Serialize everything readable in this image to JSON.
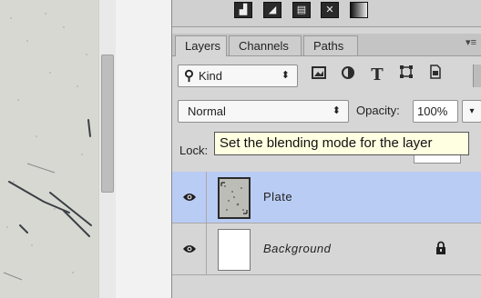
{
  "panel": {
    "tabs": [
      {
        "label": "Layers",
        "active": true
      },
      {
        "label": "Channels",
        "active": false
      },
      {
        "label": "Paths",
        "active": false
      }
    ],
    "menu_glyph": "▾≡"
  },
  "filter": {
    "kind_label": "Kind",
    "kind_arrows": "⬍",
    "icons": [
      "image-filter-icon",
      "adjustment-filter-icon",
      "type-filter-icon",
      "shape-filter-icon",
      "smart-object-filter-icon"
    ],
    "type_glyph": "T"
  },
  "blend": {
    "mode": "Normal",
    "arrows": "⬍",
    "opacity_label": "Opacity:",
    "opacity_value": "100%",
    "opacity_arrow": "▾"
  },
  "lock": {
    "label": "Lock:"
  },
  "tooltip": {
    "text": "Set the blending mode for the layer"
  },
  "layers": [
    {
      "name": "Plate",
      "visible": true,
      "selected": true,
      "italic": false,
      "locked": false
    },
    {
      "name": "Background",
      "visible": true,
      "selected": false,
      "italic": true,
      "locked": true
    }
  ],
  "colors": {
    "selected_row": "#b9ccf4",
    "tooltip_bg": "#ffffe1"
  }
}
